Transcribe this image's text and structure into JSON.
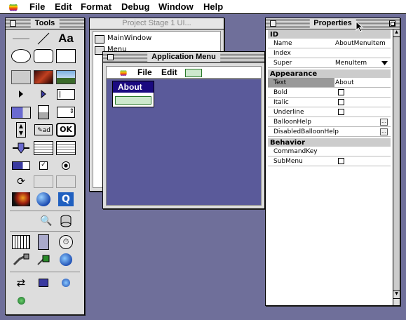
{
  "menubar": {
    "items": [
      "File",
      "Edit",
      "Format",
      "Debug",
      "Window",
      "Help"
    ]
  },
  "tools_window": {
    "title": "Tools"
  },
  "project_window": {
    "title": "Project Stage 1 UI...",
    "items": [
      "MainWindow",
      "Menu"
    ]
  },
  "app_menu_window": {
    "title": "Application Menu",
    "menus": [
      "File",
      "Edit"
    ],
    "dropdown_item": "About"
  },
  "properties": {
    "title": "Properties",
    "sections": [
      {
        "name": "ID",
        "rows": [
          {
            "key": "Name",
            "value": "AboutMenuItem"
          },
          {
            "key": "Index",
            "value": ""
          },
          {
            "key": "Super",
            "value": "MenuItem"
          }
        ]
      },
      {
        "name": "Appearance",
        "rows": [
          {
            "key": "Text",
            "value": "About"
          },
          {
            "key": "Bold",
            "value": ""
          },
          {
            "key": "Italic",
            "value": ""
          },
          {
            "key": "Underline",
            "value": ""
          },
          {
            "key": "BalloonHelp",
            "value": ""
          },
          {
            "key": "DisabledBalloonHelp",
            "value": ""
          }
        ]
      },
      {
        "name": "Behavior",
        "rows": [
          {
            "key": "CommandKey",
            "value": ""
          },
          {
            "key": "SubMenu",
            "value": ""
          }
        ]
      }
    ]
  },
  "colors": {
    "desktop": "#6f6f9a",
    "menu_dropdown_bg": "#1a0a80",
    "app_window_content": "#5a5a9a"
  }
}
